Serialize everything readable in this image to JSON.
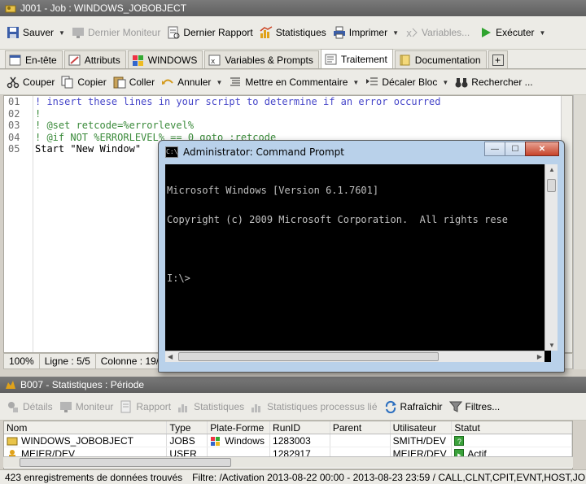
{
  "main_window": {
    "title": "J001 - Job : WINDOWS_JOBOBJECT"
  },
  "toolbar1": {
    "save": "Sauver",
    "last_monitor": "Dernier Moniteur",
    "last_report": "Dernier Rapport",
    "statistics": "Statistiques",
    "print": "Imprimer",
    "variables": "Variables...",
    "execute": "Exécuter"
  },
  "tabs": [
    "En-tête",
    "Attributs",
    "WINDOWS",
    "Variables & Prompts",
    "Traitement",
    "Documentation"
  ],
  "toolbar2": {
    "cut": "Couper",
    "copy": "Copier",
    "paste": "Coller",
    "undo": "Annuler",
    "comment": "Mettre en Commentaire",
    "shift_block": "Décaler Bloc",
    "search": "Rechercher ..."
  },
  "editor": {
    "line_numbers": [
      "01",
      "02",
      "03",
      "04",
      "05"
    ],
    "lines": [
      "! insert these lines in your script to determine if an error occurred",
      "!",
      "! @set retcode=%errorlevel%",
      "! @if NOT %ERRORLEVEL% == 0 goto :retcode",
      "Start \"New Window\""
    ]
  },
  "editor_status": {
    "zoom": "100%",
    "line": "Ligne : 5/5",
    "column": "Colonne : 19/19"
  },
  "cmd": {
    "title": "Administrator: Command Prompt",
    "icon_text": "C:\\",
    "line1": "Microsoft Windows [Version 6.1.7601]",
    "line2": "Copyright (c) 2009 Microsoft Corporation.  All rights rese",
    "line3": "",
    "line4": "I:\\>"
  },
  "stats_window": {
    "title": "B007 - Statistiques : Période"
  },
  "toolbar3": {
    "details": "Détails",
    "monitor": "Moniteur",
    "report": "Rapport",
    "statistics": "Statistiques",
    "process_stats": "Statistiques processus lié",
    "refresh": "Rafraîchir",
    "filters": "Filtres..."
  },
  "grid": {
    "headers": [
      "Nom",
      "Type",
      "Plate-Forme",
      "RunID",
      "Parent",
      "Utilisateur",
      "Statut"
    ],
    "rows": [
      [
        "WINDOWS_JOBOBJECT",
        "JOBS",
        "Windows",
        "1283003",
        "",
        "SMITH/DEV",
        "?"
      ],
      [
        "MEIER/DEV",
        "USER",
        "",
        "1282917",
        "",
        "MEIER/DEV",
        "Actif"
      ]
    ]
  },
  "bottom_status": {
    "records": "423 enregistrements de données trouvés",
    "filter": "Filtre: /Activation 2013-08-22 00:00 - 2013-08-23 23:59 / CALL,CLNT,CPIT,EVNT,HOST,JOBF,JOBG,JOBI,JOBP,JOBQ,JOBS,JSCH,MSG"
  },
  "colors": {
    "titlebar": "#6b6b6b",
    "comment_green": "#3a8a3a",
    "comment_blue": "#4646c9",
    "cmd_bg": "#000000",
    "cmd_text": "#c0c0c0"
  }
}
